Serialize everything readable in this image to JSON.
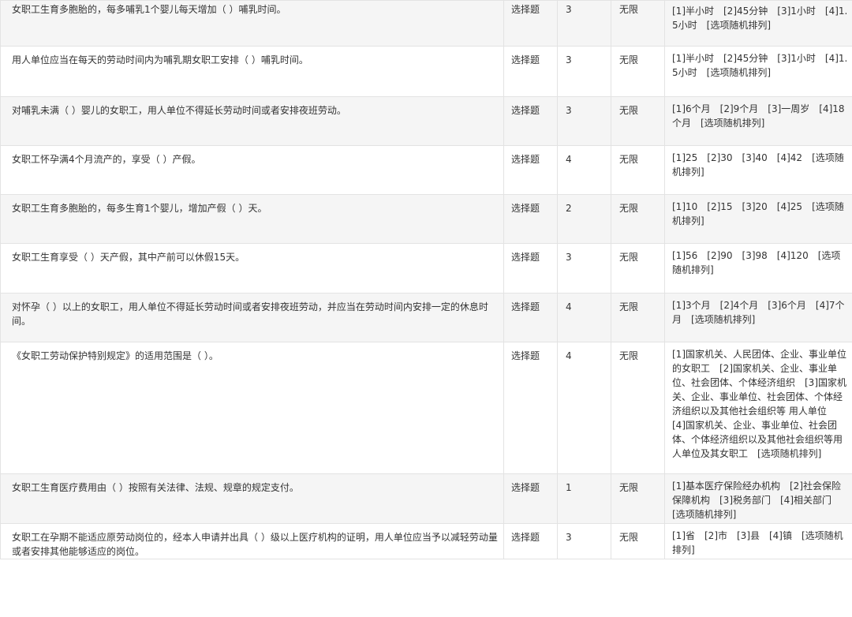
{
  "rows": [
    {
      "question": "女职工生育多胞胎的，每多哺乳1个婴儿每天增加（ ）哺乳时间。",
      "type": "选择题",
      "score": "3",
      "limit": "无限",
      "options": "[1]半小时　[2]45分钟　[3]1小时　[4]1.5小时　[选项随机排列]"
    },
    {
      "question": "用人单位应当在每天的劳动时间内为哺乳期女职工安排（ ）哺乳时间。",
      "type": "选择题",
      "score": "3",
      "limit": "无限",
      "options": "[1]半小时　[2]45分钟　[3]1小时　[4]1.5小时　[选项随机排列]"
    },
    {
      "question": "对哺乳未满（ ）婴儿的女职工，用人单位不得延长劳动时间或者安排夜班劳动。",
      "type": "选择题",
      "score": "3",
      "limit": "无限",
      "options": "[1]6个月　[2]9个月　[3]一周岁　[4]18个月　[选项随机排列]"
    },
    {
      "question": "女职工怀孕满4个月流产的，享受（ ）产假。",
      "type": "选择题",
      "score": "4",
      "limit": "无限",
      "options": "[1]25　[2]30　[3]40　[4]42　[选项随机排列]"
    },
    {
      "question": "女职工生育多胞胎的，每多生育1个婴儿，增加产假（ ）天。",
      "type": "选择题",
      "score": "2",
      "limit": "无限",
      "options": "[1]10　[2]15　[3]20　[4]25　[选项随机排列]"
    },
    {
      "question": "女职工生育享受（ ）天产假，其中产前可以休假15天。",
      "type": "选择题",
      "score": "3",
      "limit": "无限",
      "options": "[1]56　[2]90　[3]98　[4]120　[选项随机排列]"
    },
    {
      "question": "对怀孕（ ）以上的女职工，用人单位不得延长劳动时间或者安排夜班劳动，并应当在劳动时间内安排一定的休息时间。",
      "type": "选择题",
      "score": "4",
      "limit": "无限",
      "options": "[1]3个月　[2]4个月　[3]6个月　[4]7个月　[选项随机排列]"
    },
    {
      "question": "《女职工劳动保护特别规定》的适用范围是（ ）。",
      "type": "选择题",
      "score": "4",
      "limit": "无限",
      "options": "[1]国家机关、人民团体、企业、事业单位的女职工　[2]国家机关、企业、事业单位、社会团体、个体经济组织　[3]国家机关、企业、事业单位、社会团体、个体经济组织以及其他社会组织等 用人单位　[4]国家机关、企业、事业单位、社会团体、个体经济组织以及其他社会组织等用人单位及其女职工　[选项随机排列]"
    },
    {
      "question": "女职工生育医疗费用由（ ）按照有关法律、法规、规章的规定支付。",
      "type": "选择题",
      "score": "1",
      "limit": "无限",
      "options": "[1]基本医疗保险经办机构　[2]社会保险保障机构　[3]税务部门　[4]相关部门　[选项随机排列]"
    },
    {
      "question": "女职工在孕期不能适应原劳动岗位的，经本人申请并出具（ ）级以上医疗机构的证明，用人单位应当予以减轻劳动量或者安排其他能够适应的岗位。",
      "type": "选择题",
      "score": "3",
      "limit": "无限",
      "options": "[1]省　[2]市　[3]县　[4]镇　[选项随机排列]"
    }
  ]
}
